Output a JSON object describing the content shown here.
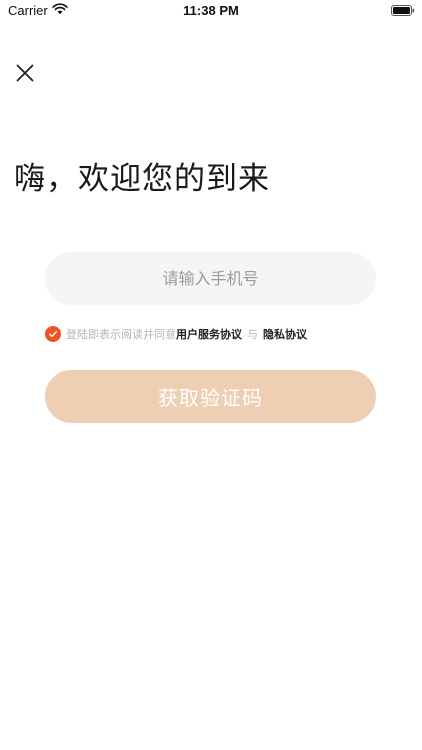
{
  "status_bar": {
    "carrier": "Carrier",
    "time": "11:38 PM"
  },
  "header": {
    "close_icon": "close-icon"
  },
  "welcome": {
    "title": "嗨，欢迎您的到来"
  },
  "phone": {
    "placeholder": "请输入手机号",
    "value": ""
  },
  "agreement": {
    "checked": true,
    "prefix": "登陆即表示阅读并同意",
    "user_agreement": "用户服务协议",
    "separator": "与",
    "privacy_agreement": "隐私协议"
  },
  "actions": {
    "get_code_label": "获取验证码"
  },
  "colors": {
    "accent": "#ee5322",
    "button_disabled": "#efcfb4",
    "input_bg": "#f5f5f5"
  }
}
